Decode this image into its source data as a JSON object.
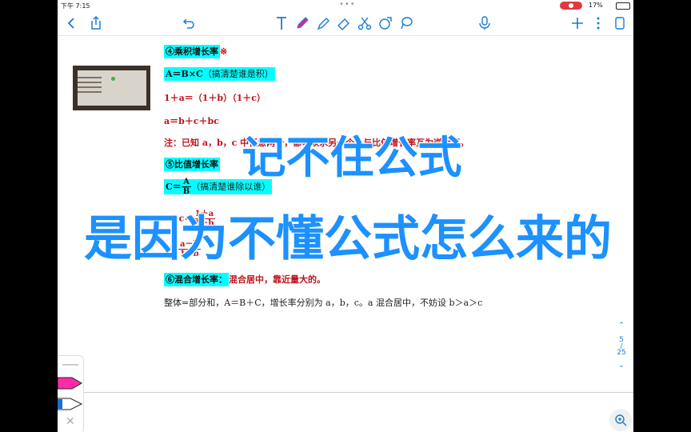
{
  "status": {
    "time": "下午 7:15",
    "battery": "17%"
  },
  "toolbar": {
    "icons": [
      "back-icon",
      "share-icon",
      "undo-icon",
      "text-tool-icon",
      "pen-icon",
      "highlighter-icon",
      "eraser-icon",
      "scissors-icon",
      "shapes-icon",
      "lasso-icon",
      "microphone-icon",
      "add-icon",
      "more-icon",
      "pages-icon"
    ]
  },
  "doc": {
    "l1_label": "④乘积增长率",
    "l1_mark": "※",
    "l2_formula": "A＝B×C",
    "l2_note": "（搞清楚谁是积）",
    "l3": "1＋a＝（1＋b）（1＋c）",
    "l4": "a＝b＋c＋bc",
    "l5": "注：已知 a，b，c 中任意两个，都可以求另一个，与比值增长率互为逆运算。",
    "l6_label": "⑤比值增长率",
    "l7_prefix": "C＝",
    "l7_num": "A",
    "l7_den": "B",
    "l7_note": "（搞清楚谁除以谁）",
    "l8_prefix": "1＋c＝",
    "l8_num": "1＋a",
    "l8_den": "1＋b",
    "l9_prefix": "c＝",
    "l9_num": "a－b",
    "l9_den": "1＋b",
    "l10_label": "⑥混合增长率：",
    "l10_text": "混合居中，靠近量大的。",
    "l11": "整体=部分和，A＝B＋C，增长率分别为 a，b，c。a 混合居中，不妨设 b＞a＞c"
  },
  "overlay": {
    "line1": "记不住公式",
    "line2": "是因为不懂公式怎么来的"
  },
  "nav": {
    "current": "5",
    "total": "25"
  },
  "colors": {
    "highlight": "#00ffff",
    "accent": "#1a7bd6",
    "red": "#c0121c",
    "overlay": "#1c91ff"
  }
}
